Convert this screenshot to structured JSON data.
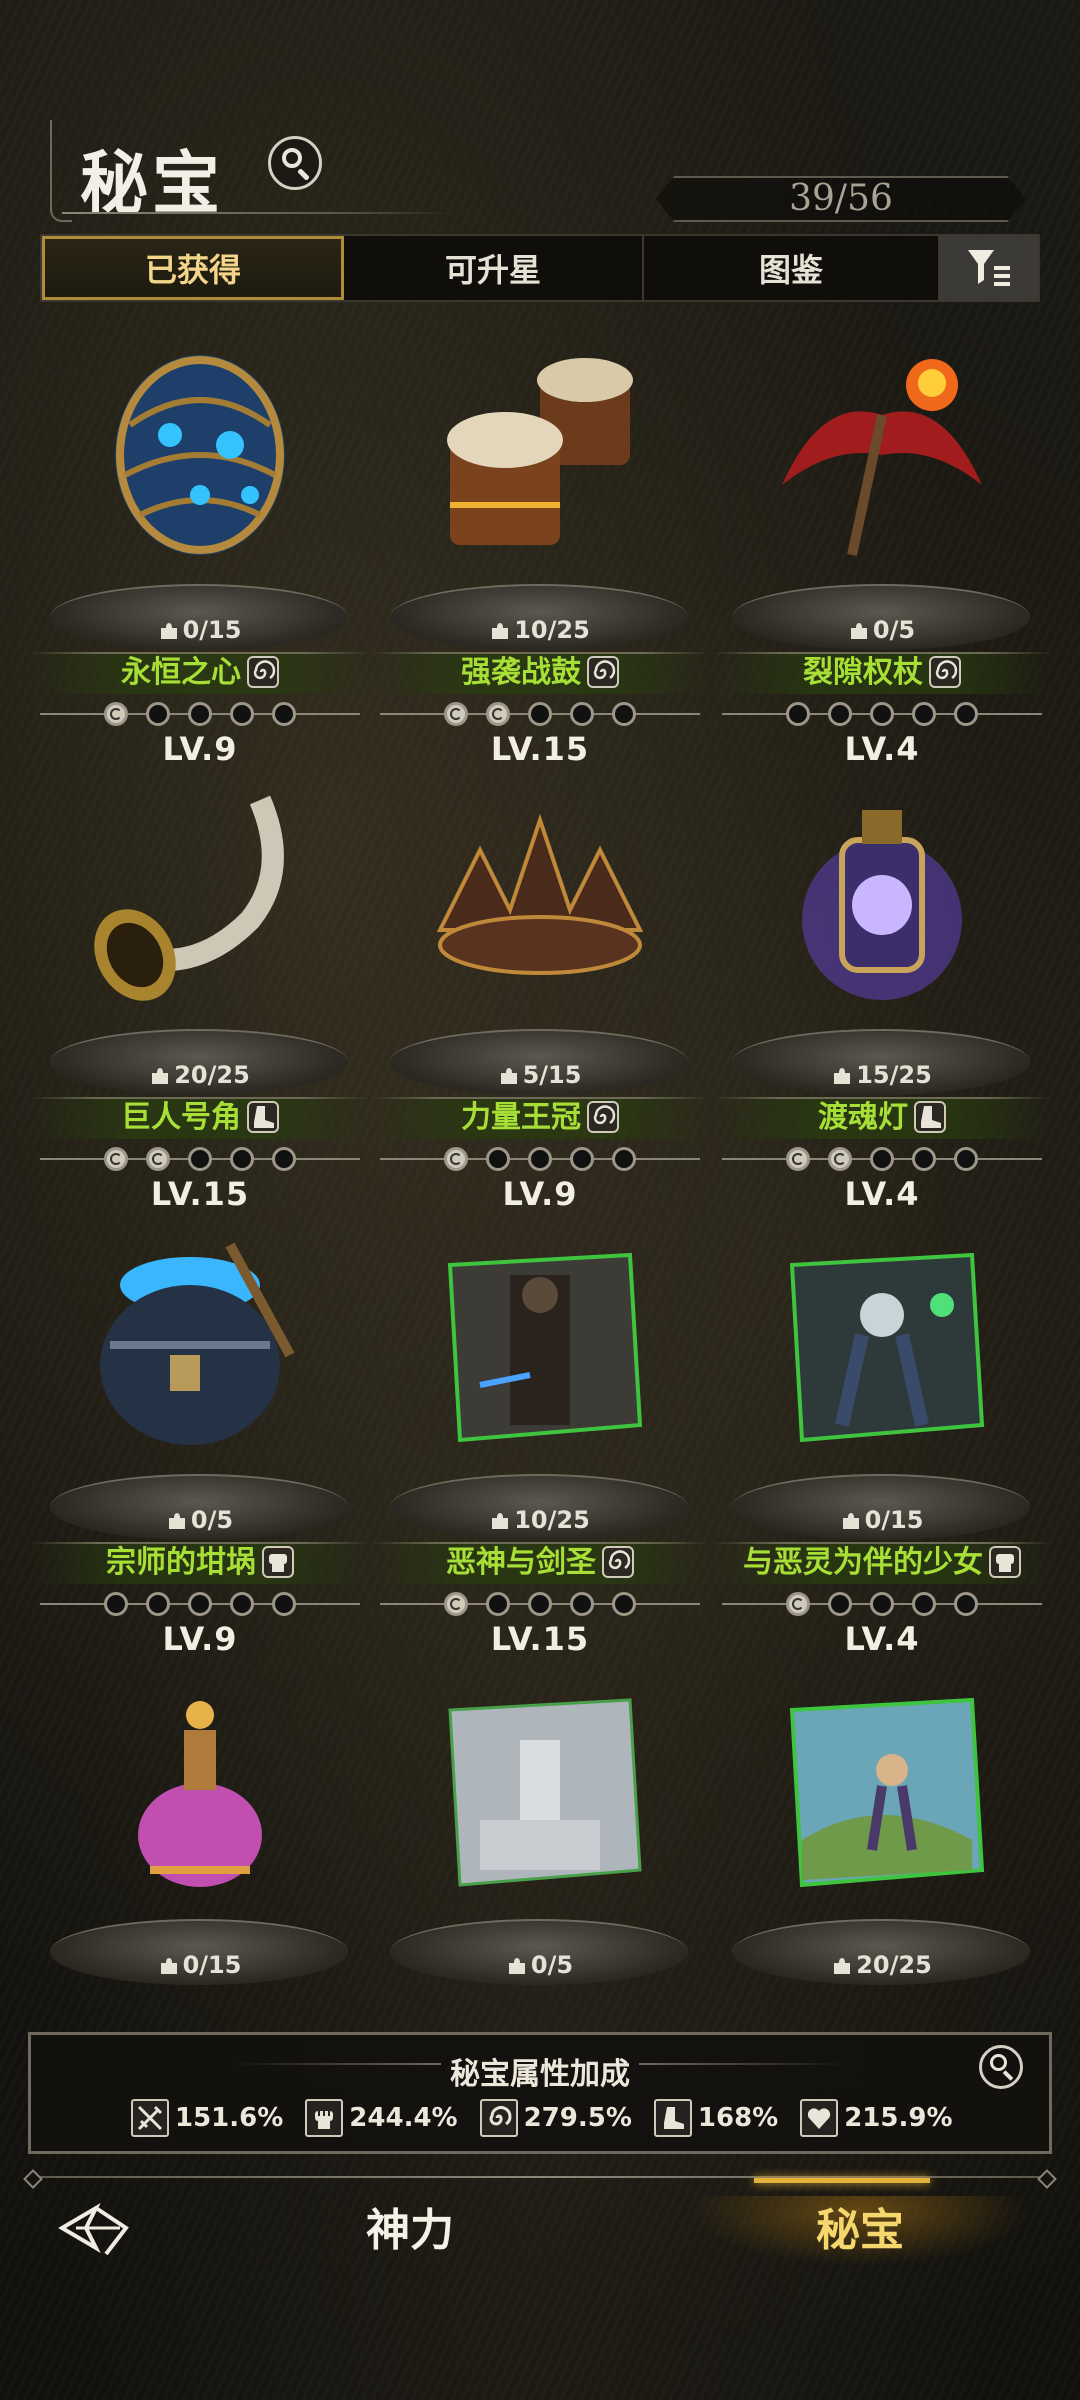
{
  "header": {
    "title": "秘宝",
    "count": "39/56"
  },
  "tabs": [
    {
      "label": "已获得",
      "active": true
    },
    {
      "label": "可升星",
      "active": false
    },
    {
      "label": "图鉴",
      "active": false
    }
  ],
  "items": [
    {
      "name": "永恒之心",
      "fragments": "0/15",
      "level": "LV.9",
      "element": "swirl-icon",
      "stars_lit": 1,
      "show_info": true
    },
    {
      "name": "强袭战鼓",
      "fragments": "10/25",
      "level": "LV.15",
      "element": "swirl-icon",
      "stars_lit": 2,
      "show_info": true
    },
    {
      "name": "裂隙权杖",
      "fragments": "0/5",
      "level": "LV.4",
      "element": "swirl-icon",
      "stars_lit": 0,
      "show_info": true
    },
    {
      "name": "巨人号角",
      "fragments": "20/25",
      "level": "LV.15",
      "element": "boot-icon",
      "stars_lit": 2,
      "show_info": true
    },
    {
      "name": "力量王冠",
      "fragments": "5/15",
      "level": "LV.9",
      "element": "swirl-icon",
      "stars_lit": 1,
      "show_info": true
    },
    {
      "name": "渡魂灯",
      "fragments": "15/25",
      "level": "LV.4",
      "element": "boot-icon",
      "stars_lit": 2,
      "show_info": true
    },
    {
      "name": "宗师的坩埚",
      "fragments": "0/5",
      "level": "LV.9",
      "element": "fist-icon",
      "stars_lit": 0,
      "show_info": true
    },
    {
      "name": "恶神与剑圣",
      "fragments": "10/25",
      "level": "LV.15",
      "element": "swirl-icon",
      "stars_lit": 1,
      "show_info": true
    },
    {
      "name": "与恶灵为伴的少女",
      "fragments": "0/15",
      "level": "LV.4",
      "element": "fist-icon",
      "stars_lit": 1,
      "show_info": true
    },
    {
      "name": "",
      "fragments": "0/15",
      "level": "",
      "element": "",
      "stars_lit": 0,
      "show_info": false
    },
    {
      "name": "",
      "fragments": "0/5",
      "level": "",
      "element": "",
      "stars_lit": 0,
      "show_info": false
    },
    {
      "name": "",
      "fragments": "20/25",
      "level": "",
      "element": "",
      "stars_lit": 0,
      "show_info": false
    }
  ],
  "bonus": {
    "title": "秘宝属性加成",
    "stats": [
      {
        "icon": "sword-icon",
        "value": "151.6%"
      },
      {
        "icon": "fist-icon",
        "value": "244.4%"
      },
      {
        "icon": "swirl-icon",
        "value": "279.5%"
      },
      {
        "icon": "boot-icon",
        "value": "168%"
      },
      {
        "icon": "heart-icon",
        "value": "215.9%"
      }
    ]
  },
  "nav": {
    "shenli": "神力",
    "mibao": "秘宝"
  },
  "colors": {
    "accent_gold": "#e4b13a",
    "name_green": "#a7df37"
  }
}
